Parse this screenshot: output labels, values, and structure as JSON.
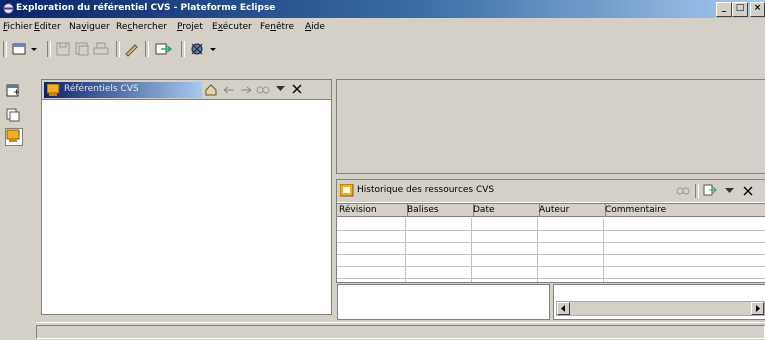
{
  "window": {
    "title": "Exploration du référentiel CVS - Plateforme Eclipse",
    "controls": {
      "minimize": "_",
      "maximize": "□",
      "close": "×"
    }
  },
  "menu": [
    {
      "label": "Fichier",
      "mnemonic": "F"
    },
    {
      "label": "Editer",
      "mnemonic": "E"
    },
    {
      "label": "Naviguer",
      "mnemonic": "v"
    },
    {
      "label": "Rechercher",
      "mnemonic": "c"
    },
    {
      "label": "Projet",
      "mnemonic": "P"
    },
    {
      "label": "Exécuter",
      "mnemonic": "x"
    },
    {
      "label": "Fenêtre",
      "mnemonic": "n"
    },
    {
      "label": "Aide",
      "mnemonic": "A"
    }
  ],
  "repositories_view": {
    "title": "Référentiels CVS"
  },
  "history_view": {
    "title": "Historique des ressources CVS",
    "columns": [
      "Révision",
      "Balises",
      "Date",
      "Auteur",
      "Commentaire"
    ],
    "rows": []
  },
  "colors": {
    "titlebar_start": "#0a246a",
    "titlebar_end": "#a6caf0",
    "chrome": "#d4d0c8"
  }
}
